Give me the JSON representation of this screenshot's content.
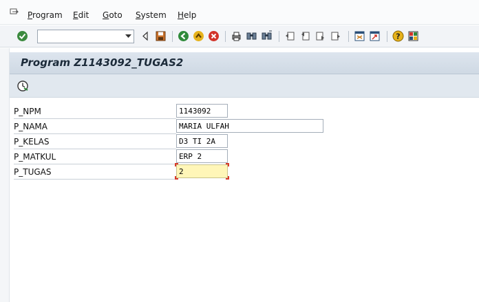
{
  "menubar": {
    "items": [
      {
        "label": "Program"
      },
      {
        "label": "Edit"
      },
      {
        "label": "Goto"
      },
      {
        "label": "System"
      },
      {
        "label": "Help"
      }
    ]
  },
  "toolbar": {
    "command_field_value": "",
    "icons": [
      "enter-icon",
      "back-arrow-icon",
      "save-icon",
      "back-icon",
      "exit-icon",
      "cancel-icon",
      "print-icon",
      "find-icon",
      "find-next-icon",
      "first-page-icon",
      "previous-page-icon",
      "next-page-icon",
      "last-page-icon",
      "create-session-icon",
      "shortcut-icon",
      "help-icon",
      "customize-layout-icon"
    ]
  },
  "title": "Program Z1143092_TUGAS2",
  "apptoolbar": {
    "icons": [
      "execute-icon"
    ]
  },
  "form": {
    "fields": [
      {
        "label": "P_NPM",
        "value": "1143092"
      },
      {
        "label": "P_NAMA",
        "value": "MARIA ULFAH"
      },
      {
        "label": "P_KELAS",
        "value": "D3 TI 2A"
      },
      {
        "label": "P_MATKUL",
        "value": "ERP 2"
      },
      {
        "label": "P_TUGAS",
        "value": "2"
      }
    ]
  },
  "colors": {
    "title_bar": "#d6dfe9",
    "active_field": "#fff6b8",
    "focus_corners": "#d83a2a"
  }
}
